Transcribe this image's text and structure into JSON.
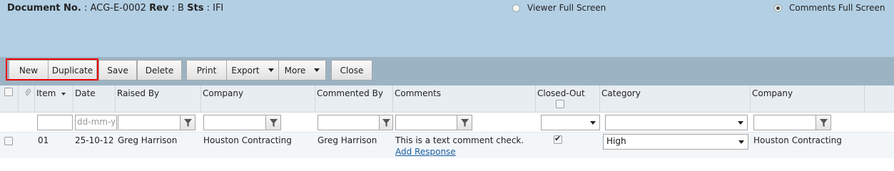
{
  "header": {
    "doc_no_label": "Document No.",
    "doc_no_value": ": ACG-E-0002",
    "rev_label": "Rev",
    "rev_value": ": B",
    "sts_label": "Sts",
    "sts_value": ": IFI",
    "viewer_option": "Viewer Full Screen",
    "comments_option": "Comments Full Screen",
    "selected_option": "comments"
  },
  "toolbar": {
    "new": "New",
    "duplicate": "Duplicate",
    "save": "Save",
    "delete": "Delete",
    "print": "Print",
    "export": "Export",
    "more": "More",
    "close": "Close"
  },
  "columns": {
    "item": "Item",
    "date": "Date",
    "raised_by": "Raised By",
    "company": "Company",
    "commented_by": "Commented By",
    "comments": "Comments",
    "closed_out": "Closed-Out",
    "category": "Category",
    "company2": "Company"
  },
  "filters": {
    "date_placeholder": "dd-mm-yyyy"
  },
  "rows": [
    {
      "item": "01",
      "date": "25-10-12",
      "raised_by": "Greg Harrison",
      "company": "Houston Contracting",
      "commented_by": "Greg Harrison",
      "comment": "This is a text comment check.",
      "add_response": "Add Response",
      "closed_out": true,
      "category": "High",
      "company2": "Houston Contracting"
    }
  ]
}
